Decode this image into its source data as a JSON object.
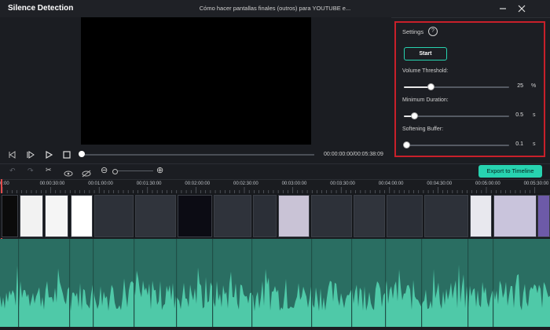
{
  "window": {
    "app_title": "Silence Detection",
    "doc_title": "Cómo hacer pantallas finales (outros) para YOUTUBE e...",
    "minimize_symbol": "—",
    "close_symbol": "✕"
  },
  "settings": {
    "title": "Settings",
    "help_symbol": "?",
    "start_label": "Start",
    "volume_threshold": {
      "label": "Volume Threshold:",
      "value": "25",
      "unit": "%",
      "level": 0.25
    },
    "minimum_duration": {
      "label": "Minimum Duration:",
      "value": "0.5",
      "unit": "s",
      "level": 0.1
    },
    "softening_buffer": {
      "label": "Softening Buffer:",
      "value": "0.1",
      "unit": "s",
      "level": 0.02
    }
  },
  "playback": {
    "time_display": "00:00:00:00/00:05:38:09",
    "progress": 0.0
  },
  "toolbar": {
    "export_label": "Export to Timeline",
    "zoom_out_symbol": "⊖",
    "zoom_in_symbol": "⊕"
  },
  "ruler": {
    "labels": [
      "0:00",
      "00:00:30:00",
      "00:01:00:00",
      "00:01:30:00",
      "00:02:00:00",
      "00:02:30:00",
      "00:03:00:00",
      "00:03:30:00",
      "00:04:00:00",
      "00:04:30:00",
      "00:05:00:00",
      "00:05:30:00"
    ]
  },
  "colors": {
    "accent": "#27d3b0",
    "highlight_border": "#c8202a",
    "audio_bg": "#2a6e62",
    "waveform": "#4fc9a8"
  }
}
